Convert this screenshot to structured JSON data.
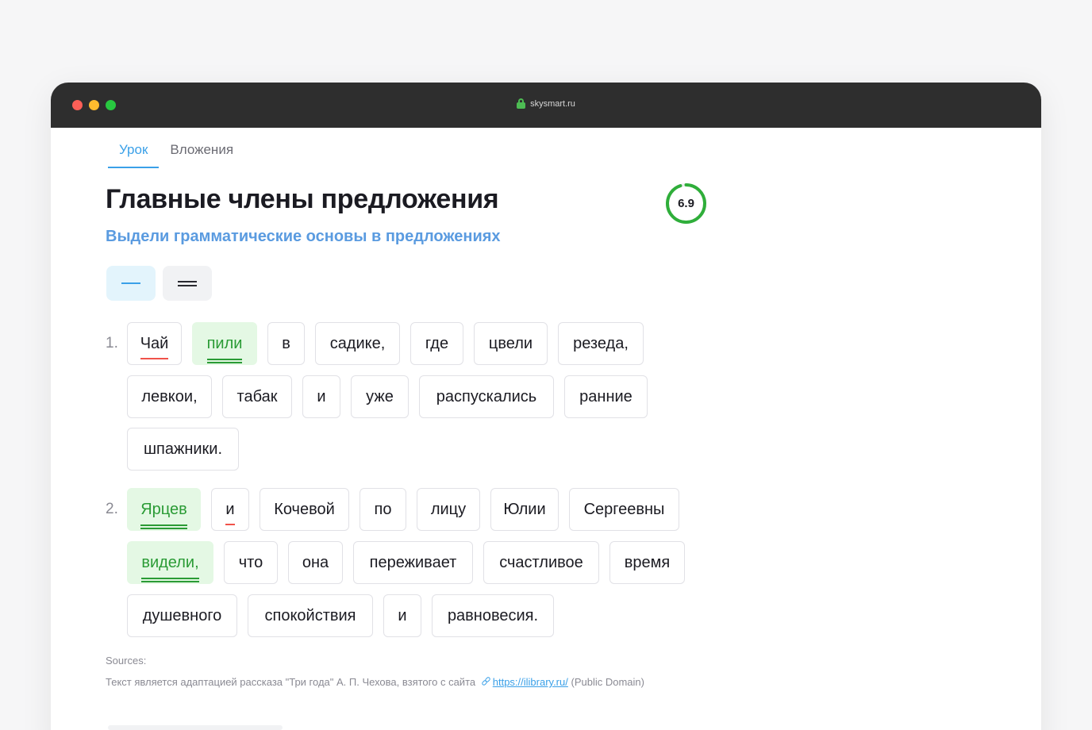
{
  "browser": {
    "url": "skysmart.ru"
  },
  "tabs": [
    {
      "label": "Урок"
    },
    {
      "label": "Вложения"
    }
  ],
  "lesson": {
    "title": "Главные члены предложения",
    "subtitle": "Выдели грамматические основы в предложениях",
    "score": "6.9",
    "score_progress": 0.95
  },
  "tools": {
    "single_line": "subject-underline-tool",
    "double_line": "predicate-underline-tool"
  },
  "sentences": [
    {
      "number": "1.",
      "words": [
        "Чай",
        "пили",
        "в",
        "садике,",
        "где",
        "цвели",
        "резеда,",
        "левкои,",
        "табак",
        "и",
        "уже",
        "распускались",
        "ранние",
        "шпажники."
      ]
    },
    {
      "number": "2.",
      "words": [
        "Ярцев",
        "и",
        "Кочевой",
        "по",
        "лицу",
        "Юлии",
        "Сергеевны",
        "видели,",
        "что",
        "она",
        "переживает",
        "счастливое",
        "время",
        "душевного",
        "спокойствия",
        "и",
        "равновесия."
      ]
    }
  ],
  "sources": {
    "label": "Sources:",
    "text": "Текст является адаптацией рассказа \"Три года\" А. П. Чехова, взятого с сайта",
    "link": "https://ilibrary.ru/",
    "license": "(Public Domain)"
  },
  "colors": {
    "accent": "#3aa0e8",
    "subject_underline": "#f0524a",
    "predicate": "#2a9b35",
    "predicate_bg": "#e4f8e4"
  }
}
